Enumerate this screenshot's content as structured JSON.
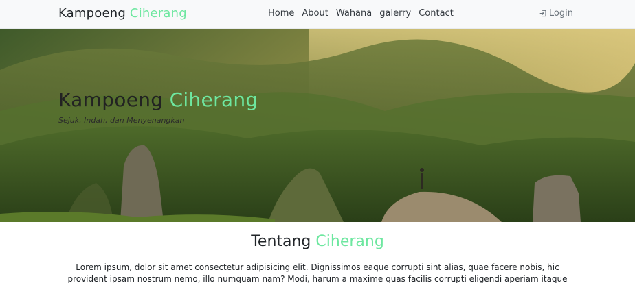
{
  "navbar": {
    "brand_main": "Kampoeng",
    "brand_accent": "Ciherang",
    "links": [
      "Home",
      "About",
      "Wahana",
      "galerry",
      "Contact"
    ],
    "login_label": "Login",
    "login_icon": "login-icon"
  },
  "hero": {
    "title_main": "Kampoeng",
    "title_accent": "Ciherang",
    "subtitle": "Sejuk, Indah, dan Menyenangkan"
  },
  "about": {
    "title_main": "Tentang",
    "title_accent": "Ciherang",
    "text": "Lorem ipsum, dolor sit amet consectetur adipisicing elit. Dignissimos eaque corrupti sint alias, quae facere nobis, hic provident ipsam nostrum nemo, illo numquam nam? Modi, harum a maxime quas facilis corrupti eligendi aperiam itaque cupiditate, vitae deleniti"
  },
  "colors": {
    "accent": "#6ee7a0",
    "navbar_bg": "#f8f9fa"
  }
}
